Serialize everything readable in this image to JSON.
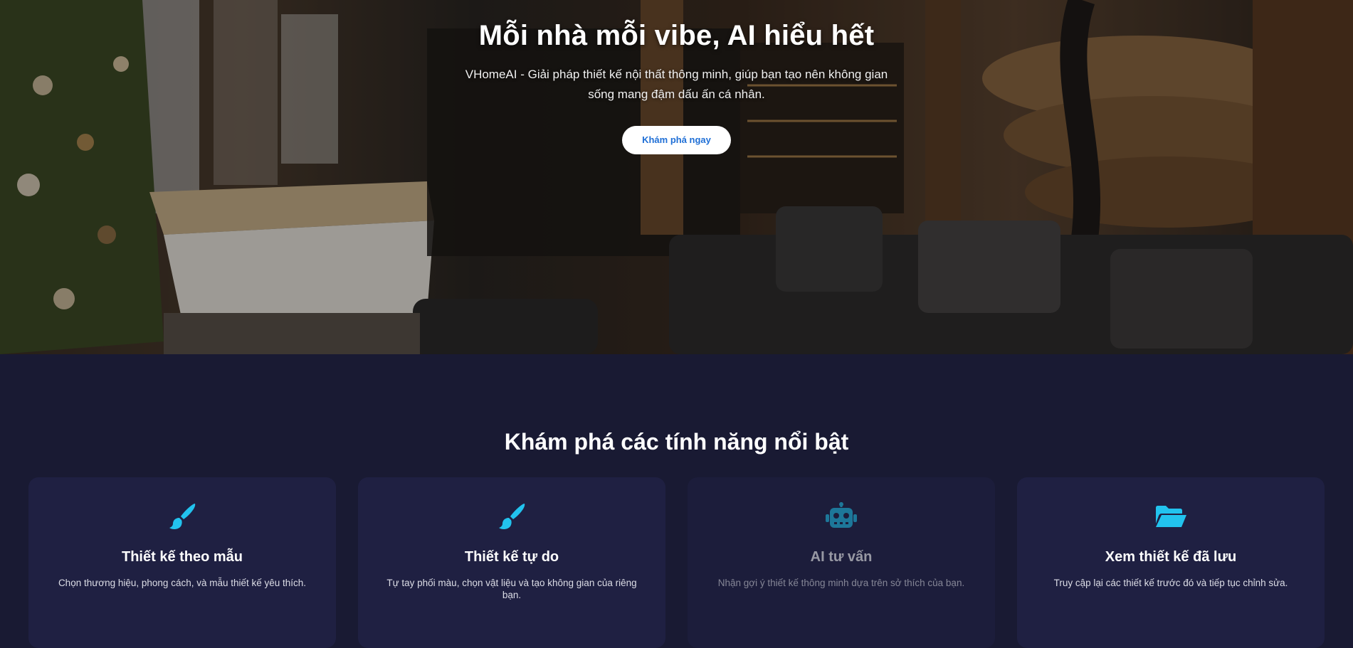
{
  "hero": {
    "title": "Mỗi nhà mỗi vibe, AI hiểu hết",
    "subtitle": "VHomeAI - Giải pháp thiết kế nội thất thông minh, giúp bạn tạo nên không gian sống mang đậm dấu ấn cá nhân.",
    "cta_label": "Khám phá ngay",
    "background": "living-room-with-billiard-table-and-spiral-staircase"
  },
  "features": {
    "title": "Khám phá các tính năng nổi bật",
    "accent_color": "#22c3ee",
    "cards": [
      {
        "icon": "paintbrush-icon",
        "title": "Thiết kế theo mẫu",
        "description": "Chọn thương hiệu, phong cách, và mẫu thiết kế yêu thích."
      },
      {
        "icon": "paintbrush-icon",
        "title": "Thiết kế tự do",
        "description": "Tự tay phối màu, chọn vật liệu và tạo không gian của riêng bạn."
      },
      {
        "icon": "robot-icon",
        "title": "AI tư vấn",
        "description": "Nhận gợi ý thiết kế thông minh dựa trên sở thích của bạn."
      },
      {
        "icon": "folder-open-icon",
        "title": "Xem thiết kế đã lưu",
        "description": "Truy cập lại các thiết kế trước đó và tiếp tục chỉnh sửa."
      }
    ]
  }
}
